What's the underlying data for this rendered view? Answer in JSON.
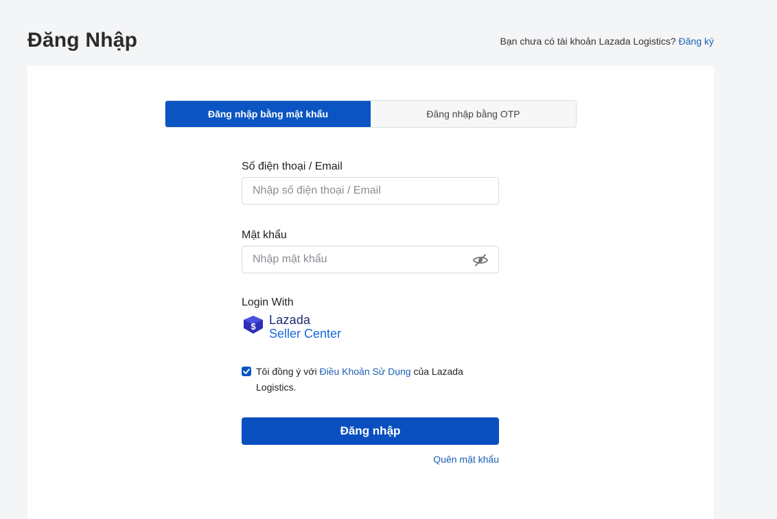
{
  "header": {
    "title": "Đăng Nhập",
    "no_account_text": "Bạn chưa có tài khoản Lazada Logistics?",
    "register_link": "Đăng ký"
  },
  "tabs": [
    {
      "label": "Đăng nhập bằng mật khẩu",
      "active": true
    },
    {
      "label": "Đăng nhập bằng OTP",
      "active": false
    }
  ],
  "form": {
    "phone_email": {
      "label": "Số điện thoại / Email",
      "placeholder": "Nhập số điện thoại / Email",
      "value": ""
    },
    "password": {
      "label": "Mật khẩu",
      "placeholder": "Nhập mật khẩu",
      "value": "",
      "toggle_icon": "eye-slash-icon"
    },
    "login_with": {
      "label": "Login With",
      "provider_line1": "Lazada",
      "provider_line2": "Seller Center",
      "icon": "lazada-logo-icon"
    },
    "terms": {
      "checked": true,
      "prefix": "Tôi đồng ý với",
      "link": "Điều Khoản Sử Dụng",
      "suffix": "của Lazada Logistics."
    },
    "submit_label": "Đăng nhập",
    "forgot_password": "Quên mật khẩu"
  },
  "colors": {
    "primary": "#0a55c2",
    "link": "#1a5fb4",
    "background": "#f4f5f7",
    "card": "#ffffff"
  }
}
